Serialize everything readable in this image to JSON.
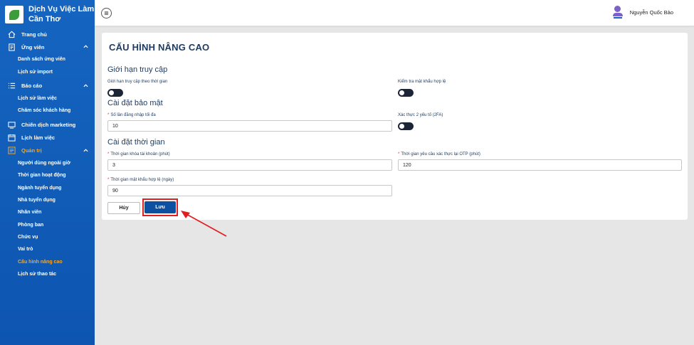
{
  "brand": {
    "line1": "Dịch Vụ Việc Làm",
    "line2": "Cần Thơ"
  },
  "sidebar": {
    "trang_chu": "Trang chủ",
    "ung_vien": "Ứng viên",
    "ung_vien_items": [
      "Danh sách ứng viên",
      "Lịch sử import"
    ],
    "bao_cao": "Báo cáo",
    "bao_cao_items": [
      "Lịch sử làm việc",
      "Chăm sóc khách hàng"
    ],
    "chien_dich": "Chiến dịch marketing",
    "lich_lam_viec": "Lịch làm việc",
    "quan_tri": "Quản trị",
    "quan_tri_items": [
      "Người dùng ngoài giờ",
      "Thời gian hoạt động",
      "Ngành tuyển dụng",
      "Nhà tuyển dụng",
      "Nhân viên",
      "Phòng ban",
      "Chức vụ",
      "Vai trò",
      "Cấu hình nâng cao",
      "Lịch sử thao tác"
    ],
    "active_item": "Cấu hình nâng cao",
    "accent_color": "#f6a623"
  },
  "topbar": {
    "user_name": "Nguyễn Quốc Bảo"
  },
  "page": {
    "title": "CẤU HÌNH NÂNG CAO",
    "sections": {
      "access": {
        "title": "Giới hạn truy cập",
        "time_limit_label": "Giới hạn truy cập theo thời gian",
        "password_check_label": "Kiểm tra mật khẩu hợp lệ"
      },
      "security": {
        "title": "Cài đặt bảo mật",
        "max_login_label": "Số lần đăng nhập tối đa",
        "max_login_value": "10",
        "twofa_label": "Xác thực 2 yếu tố (2FA)"
      },
      "time": {
        "title": "Cài đặt thời gian",
        "lock_time_label": "Thời gian khóa tài khoản (phút)",
        "lock_time_value": "3",
        "otp_label": "Thời gian yêu cầu xác thực lại OTP (phút)",
        "otp_value": "120",
        "password_valid_label": "Thời gian mật khẩu hợp lệ (ngày)",
        "password_valid_value": "90"
      }
    },
    "buttons": {
      "cancel": "Hủy",
      "save": "Lưu"
    }
  },
  "colors": {
    "sidebar": "#1565c0",
    "primary_button": "#0d4fa0",
    "highlight": "#e02020"
  }
}
